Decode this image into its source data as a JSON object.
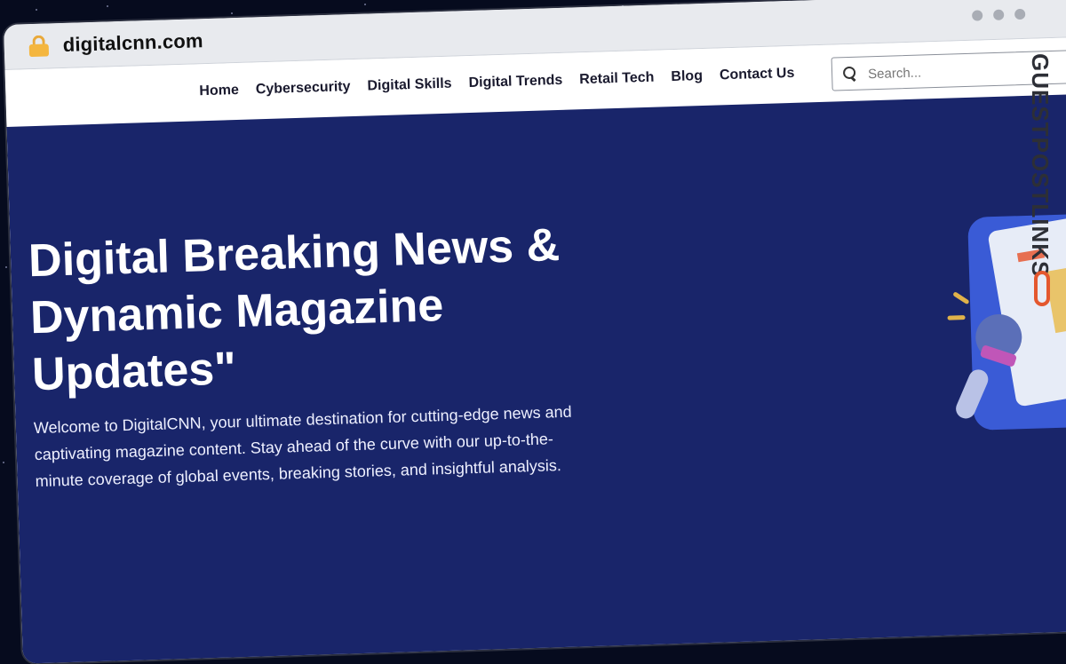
{
  "browser": {
    "url": "digitalcnn.com",
    "lock_icon": "lock-icon",
    "lock_color": "#f4b63f"
  },
  "nav": {
    "items": [
      {
        "label": "Home"
      },
      {
        "label": "Cybersecurity"
      },
      {
        "label": "Digital Skills"
      },
      {
        "label": "Digital Trends"
      },
      {
        "label": "Retail Tech"
      },
      {
        "label": "Blog"
      },
      {
        "label": "Contact Us"
      }
    ],
    "search": {
      "placeholder": "Search...",
      "value": "",
      "icon": "search-icon"
    }
  },
  "hero": {
    "title": "Digital Breaking News & Dynamic Magazine Updates\"",
    "description": "Welcome to DigitalCNN, your ultimate destination for cutting-edge news and captivating magazine content. Stay ahead of the curve with our up-to-the-minute coverage of global events, breaking stories, and insightful analysis.",
    "background_color": "#19256a"
  },
  "watermark": {
    "text": "GUESTPOSTLINKS",
    "accent_color": "#e4572e"
  }
}
